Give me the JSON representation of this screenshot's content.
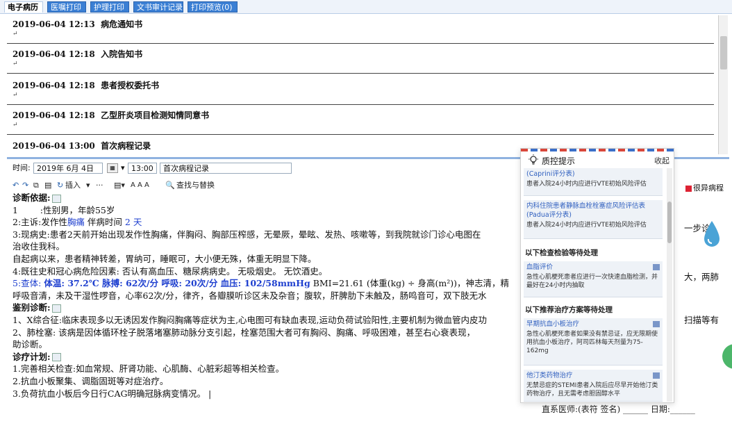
{
  "tabs": [
    "电子病历",
    "医嘱打印",
    "护理打印",
    "文书审计记录",
    "打印预览(0)"
  ],
  "records": [
    {
      "datetime": "2019-06-04 12:13",
      "title": "病危通知书",
      "marker": "↵"
    },
    {
      "datetime": "2019-06-04 12:18",
      "title": "入院告知书",
      "marker": "↵"
    },
    {
      "datetime": "2019-06-04 12:18",
      "title": "患者授权委托书",
      "marker": "↵"
    },
    {
      "datetime": "2019-06-04 12:18",
      "title": "乙型肝炎项目检测知情同意书",
      "marker": "↵"
    },
    {
      "datetime": "2019-06-04 13:00",
      "title": "首次病程记录",
      "marker": ""
    }
  ],
  "meta": {
    "time_label": "时间:",
    "date_value": "2019年 6月 4日",
    "time_value": "13:00",
    "record_type": "首次病程记录"
  },
  "toolbar": {
    "insert": "插入",
    "find_replace": "查找与替换",
    "dots": "···",
    "fonts": "A A A"
  },
  "right_button": "很异病程",
  "doc": {
    "diag_basis": "诊断依据:",
    "line1_a": "1",
    "line1_b": ":性别男，年龄55岁",
    "line2_a": "2:主诉:发作性",
    "line2_b": "胸痛",
    "line2_c": "伴病时间",
    "line2_d": "2 天",
    "line3": "3:现病史:患者2天前开始出现发作性胸痛，伴胸闷、胸部压榨感，无晕厥，晕眩、发热、咳嗽等，到我院就诊门诊心电图在",
    "line3_right": "一步诊",
    "line4": "治收住我科。",
    "line5": "    自起病以来，患者精神转差，胃纳可，睡眠可，大小便无殊，体重无明显下降。",
    "line6": "4:既往史和冠心病危险因素: 否认有高血压、糖尿病病史。 无吸烟史。 无饮酒史。",
    "line7_a": "5:查体:",
    "line7_b": "体温: 37.2℃ 脉搏: 62次/分 呼吸: 20次/分 血压: 102/58mmHg",
    "line7_c": "BMI=21.61 (体重(kg) ÷ 身高(m²))，神志清，精",
    "line7_right": "大，两肺",
    "line8": "呼吸音清，未及干湿性啰音，心率62次/分，律齐，各瓣膜听诊区未及杂音；腹软，肝脾肋下未触及，肠鸣音可，双下肢无水",
    "diff_title": "鉴别诊断:",
    "line10": "1、X综合征:临床表现多以无诱因发作胸闷胸痛等症状为主,心电图可有缺血表现,运动负荷试验阳性,主要机制为微血管内皮功",
    "line11": "2、肺栓塞: 该病是因体循环栓子脱落堵塞肺动脉分支引起，栓塞范围大者可有胸闷、胸痛、呼吸困难，甚至右心衰表现，",
    "line11_right": "扫描等有",
    "line12": "助诊断。",
    "plan_title": "诊疗计划:",
    "line14": "1.完善相关检查:如血常规、肝肾功能、心肌酶、心脏彩超等相关检查。",
    "line15": "2.抗血小板聚集、调脂固斑等对症治疗。",
    "line16": "3.负荷抗血小板后今日行CAG明确冠脉病变情况。 |"
  },
  "signature": "直系医师:(表符 签名) ______  日期:______",
  "qc_panel": {
    "title": "质控提示",
    "close": "收起",
    "cards": [
      {
        "title": "(Caprini评分表)",
        "body": "患者入院24小时内应进行VTE初始风险评估"
      },
      {
        "title": "内科住院患者静脉血栓栓塞症风险评估表(Padua评分表)",
        "body": "患者入院24小时内应进行VTE初始风险评估"
      }
    ],
    "group1": "以下检查检验等待处理",
    "card3": {
      "title": "血脂评价",
      "body": "急性心肌梗死患者应进行一次快速血脂检测，并最好在24小时内抽取"
    },
    "group2": "以下推荐治疗方案等待处理",
    "card4": {
      "title": "早期抗血小板治疗",
      "body": "急性心肌梗死患者如果没有禁忌证，应无限期使用抗血小板治疗，阿司匹林每天剂量为75-162mg"
    },
    "card5": {
      "title": "他汀类药物治疗",
      "body": "无禁忌症的STEMI患者入院后应尽早开始他汀类药物治疗，且无需考虑胆固醇水平"
    }
  }
}
